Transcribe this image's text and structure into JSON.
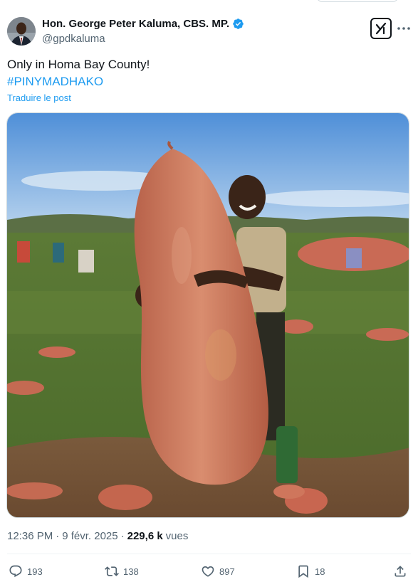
{
  "author": {
    "name": "Hon. George Peter Kaluma, CBS. MP.",
    "handle": "@gpdkaluma",
    "verified_color": "#1d9bf0"
  },
  "post": {
    "text": "Only in Homa Bay County!",
    "hashtag": "#PINYMADHAKO",
    "translate_link": "Traduire le post",
    "image_alt": "Man hugging a giant sweet potato in a farm field"
  },
  "meta": {
    "time": "12:36 PM",
    "separator": "·",
    "date": "9 févr. 2025",
    "views_count": "229,6 k",
    "views_label": "vues"
  },
  "actions": {
    "replies": "193",
    "reposts": "138",
    "likes": "897",
    "bookmarks": "18"
  },
  "icons": {
    "grok": "grok-icon",
    "more": "more-icon",
    "reply": "reply-icon",
    "repost": "repost-icon",
    "like": "heart-icon",
    "bookmark": "bookmark-icon",
    "share": "share-icon"
  },
  "colors": {
    "accent": "#1d9bf0",
    "text_primary": "#0f1419",
    "text_secondary": "#536471"
  }
}
